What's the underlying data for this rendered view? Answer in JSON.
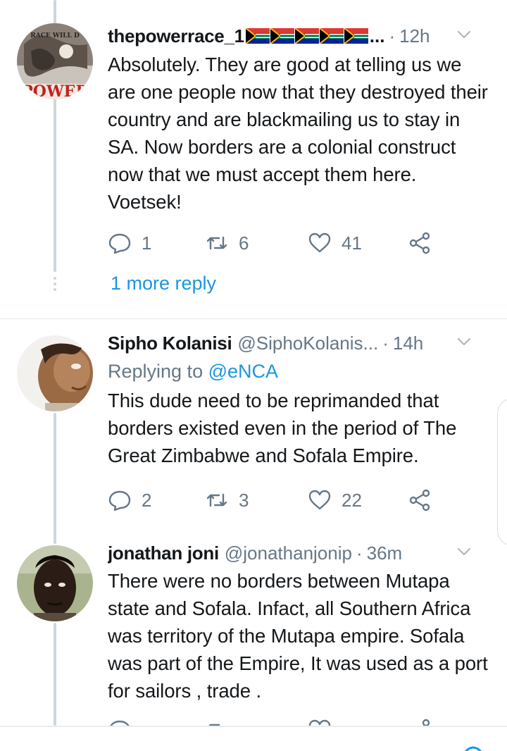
{
  "tweets": [
    {
      "name": "thepowerrace_1",
      "handle": "",
      "time": "12h",
      "ellipsis": "...",
      "replying_to": "",
      "text": "Absolutely. They are good at telling us we are one people now that they destroyed their country and are blackmailing us to stay in SA. Now borders are a colonial construct now that we must accept them here. Voetsek!",
      "avatar_text_top": "RACE WILL D",
      "avatar_text_bottom": "POWER",
      "reply_count": "1",
      "retweet_count": "6",
      "like_count": "41"
    },
    {
      "name": "Sipho Kolanisi",
      "handle": "@SiphoKolanis...",
      "time": "14h",
      "replying_label": "Replying to ",
      "replying_to": "@eNCA",
      "text": "This dude need to be reprimanded that borders existed even in the period of The Great Zimbabwe and Sofala Empire.",
      "reply_count": "2",
      "retweet_count": "3",
      "like_count": "22"
    },
    {
      "name": "jonathan joni",
      "handle": "@jonathanjonip",
      "time": "36m",
      "replying_to": "",
      "text": "There were no borders between Mutapa state and Sofala. Infact, all Southern Africa was territory of the Mutapa empire. Sofala was part of the Empire, It was used as a port for sailors , trade ."
    }
  ],
  "more_replies": "1 more reply",
  "separator_dot": "·",
  "colors": {
    "link": "#1b95e0",
    "secondary": "#657786",
    "thread_line": "#ccd6dd",
    "divider": "#e1e8ed"
  },
  "icons": [
    "reply-icon",
    "retweet-icon",
    "like-icon",
    "share-icon",
    "chevron-down-icon",
    "south-africa-flag-icon"
  ]
}
